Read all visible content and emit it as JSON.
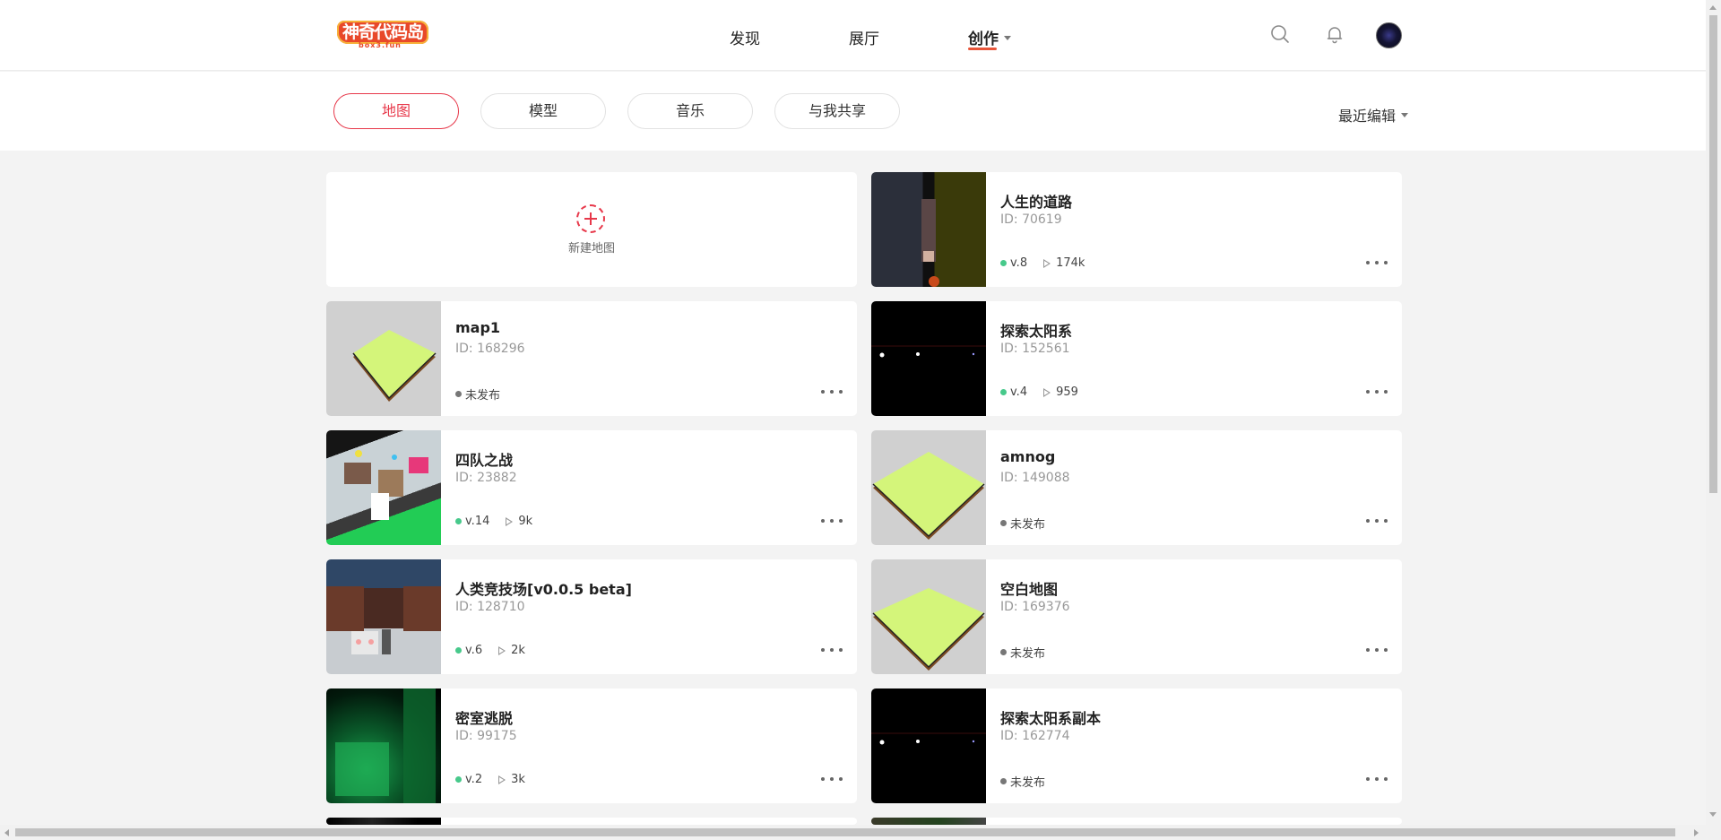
{
  "header": {
    "logo_text": "神奇代码岛",
    "logo_sub": "box3.fun",
    "nav": [
      {
        "label": "发现"
      },
      {
        "label": "展厅"
      },
      {
        "label": "创作"
      }
    ],
    "accent_color": "#e8553a"
  },
  "filters": {
    "tabs": [
      {
        "label": "地图",
        "active": true
      },
      {
        "label": "模型",
        "active": false
      },
      {
        "label": "音乐",
        "active": false
      },
      {
        "label": "与我共享",
        "active": false
      }
    ],
    "sort_label": "最近编辑",
    "active_color": "#e7384a"
  },
  "new_map": {
    "label": "新建地图"
  },
  "cards": [
    {
      "title": "人生的道路",
      "id": "ID: 70619",
      "version": "v.8",
      "plays": "174k",
      "status": "published",
      "thumb": "road"
    },
    {
      "title": "map1",
      "id": "ID: 168296",
      "status_text": "未发布",
      "status": "unpublished",
      "thumb": "grey-tile"
    },
    {
      "title": "探索太阳系",
      "id": "ID: 152561",
      "version": "v.4",
      "plays": "959",
      "status": "published",
      "thumb": "space"
    },
    {
      "title": "四队之战",
      "id": "ID: 23882",
      "version": "v.14",
      "plays": "9k",
      "status": "published",
      "thumb": "colorful-arena"
    },
    {
      "title": "amnog",
      "id": "ID: 149088",
      "status_text": "未发布",
      "status": "unpublished",
      "thumb": "grey-tile"
    },
    {
      "title": "人类竞技场[v0.0.5 beta]",
      "id": "ID: 128710",
      "version": "v.6",
      "plays": "2k",
      "status": "published",
      "thumb": "brick-arena"
    },
    {
      "title": "空白地图",
      "id": "ID: 169376",
      "status_text": "未发布",
      "status": "unpublished",
      "thumb": "grey-tile"
    },
    {
      "title": "密室逃脱",
      "id": "ID: 99175",
      "version": "v.2",
      "plays": "3k",
      "status": "published",
      "thumb": "green-room"
    },
    {
      "title": "探索太阳系副本",
      "id": "ID: 162774",
      "status_text": "未发布",
      "status": "unpublished",
      "thumb": "space"
    }
  ],
  "status_colors": {
    "published": "#47c98b",
    "unpublished": "#777777"
  }
}
